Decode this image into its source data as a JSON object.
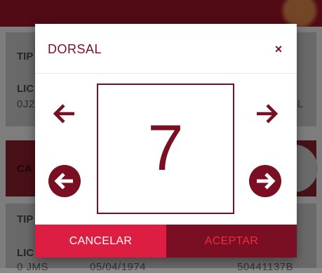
{
  "background": {
    "card1": {
      "label1": "TIP",
      "label2": "LIC",
      "value2": "0J2",
      "value2_right": "L"
    },
    "card2": {
      "label": "CA"
    },
    "card3": {
      "label1": "TIP",
      "label2": "LIC",
      "row_values": [
        "0 JMS",
        "05/04/1974",
        "50441137B"
      ]
    }
  },
  "dialog": {
    "title": "DORSAL",
    "close_label": "×",
    "number": "7",
    "cancel_label": "CANCELAR",
    "accept_label": "ACEPTAR"
  },
  "icons": {
    "prev": "arrow-left-icon",
    "next": "arrow-right-icon",
    "prev_fast": "circle-arrow-left-icon",
    "next_fast": "circle-arrow-right-icon",
    "close": "close-icon"
  },
  "colors": {
    "brand_dark": "#7a0f24",
    "brand_red": "#dd1d41",
    "accept_text": "#ee2a3f"
  }
}
